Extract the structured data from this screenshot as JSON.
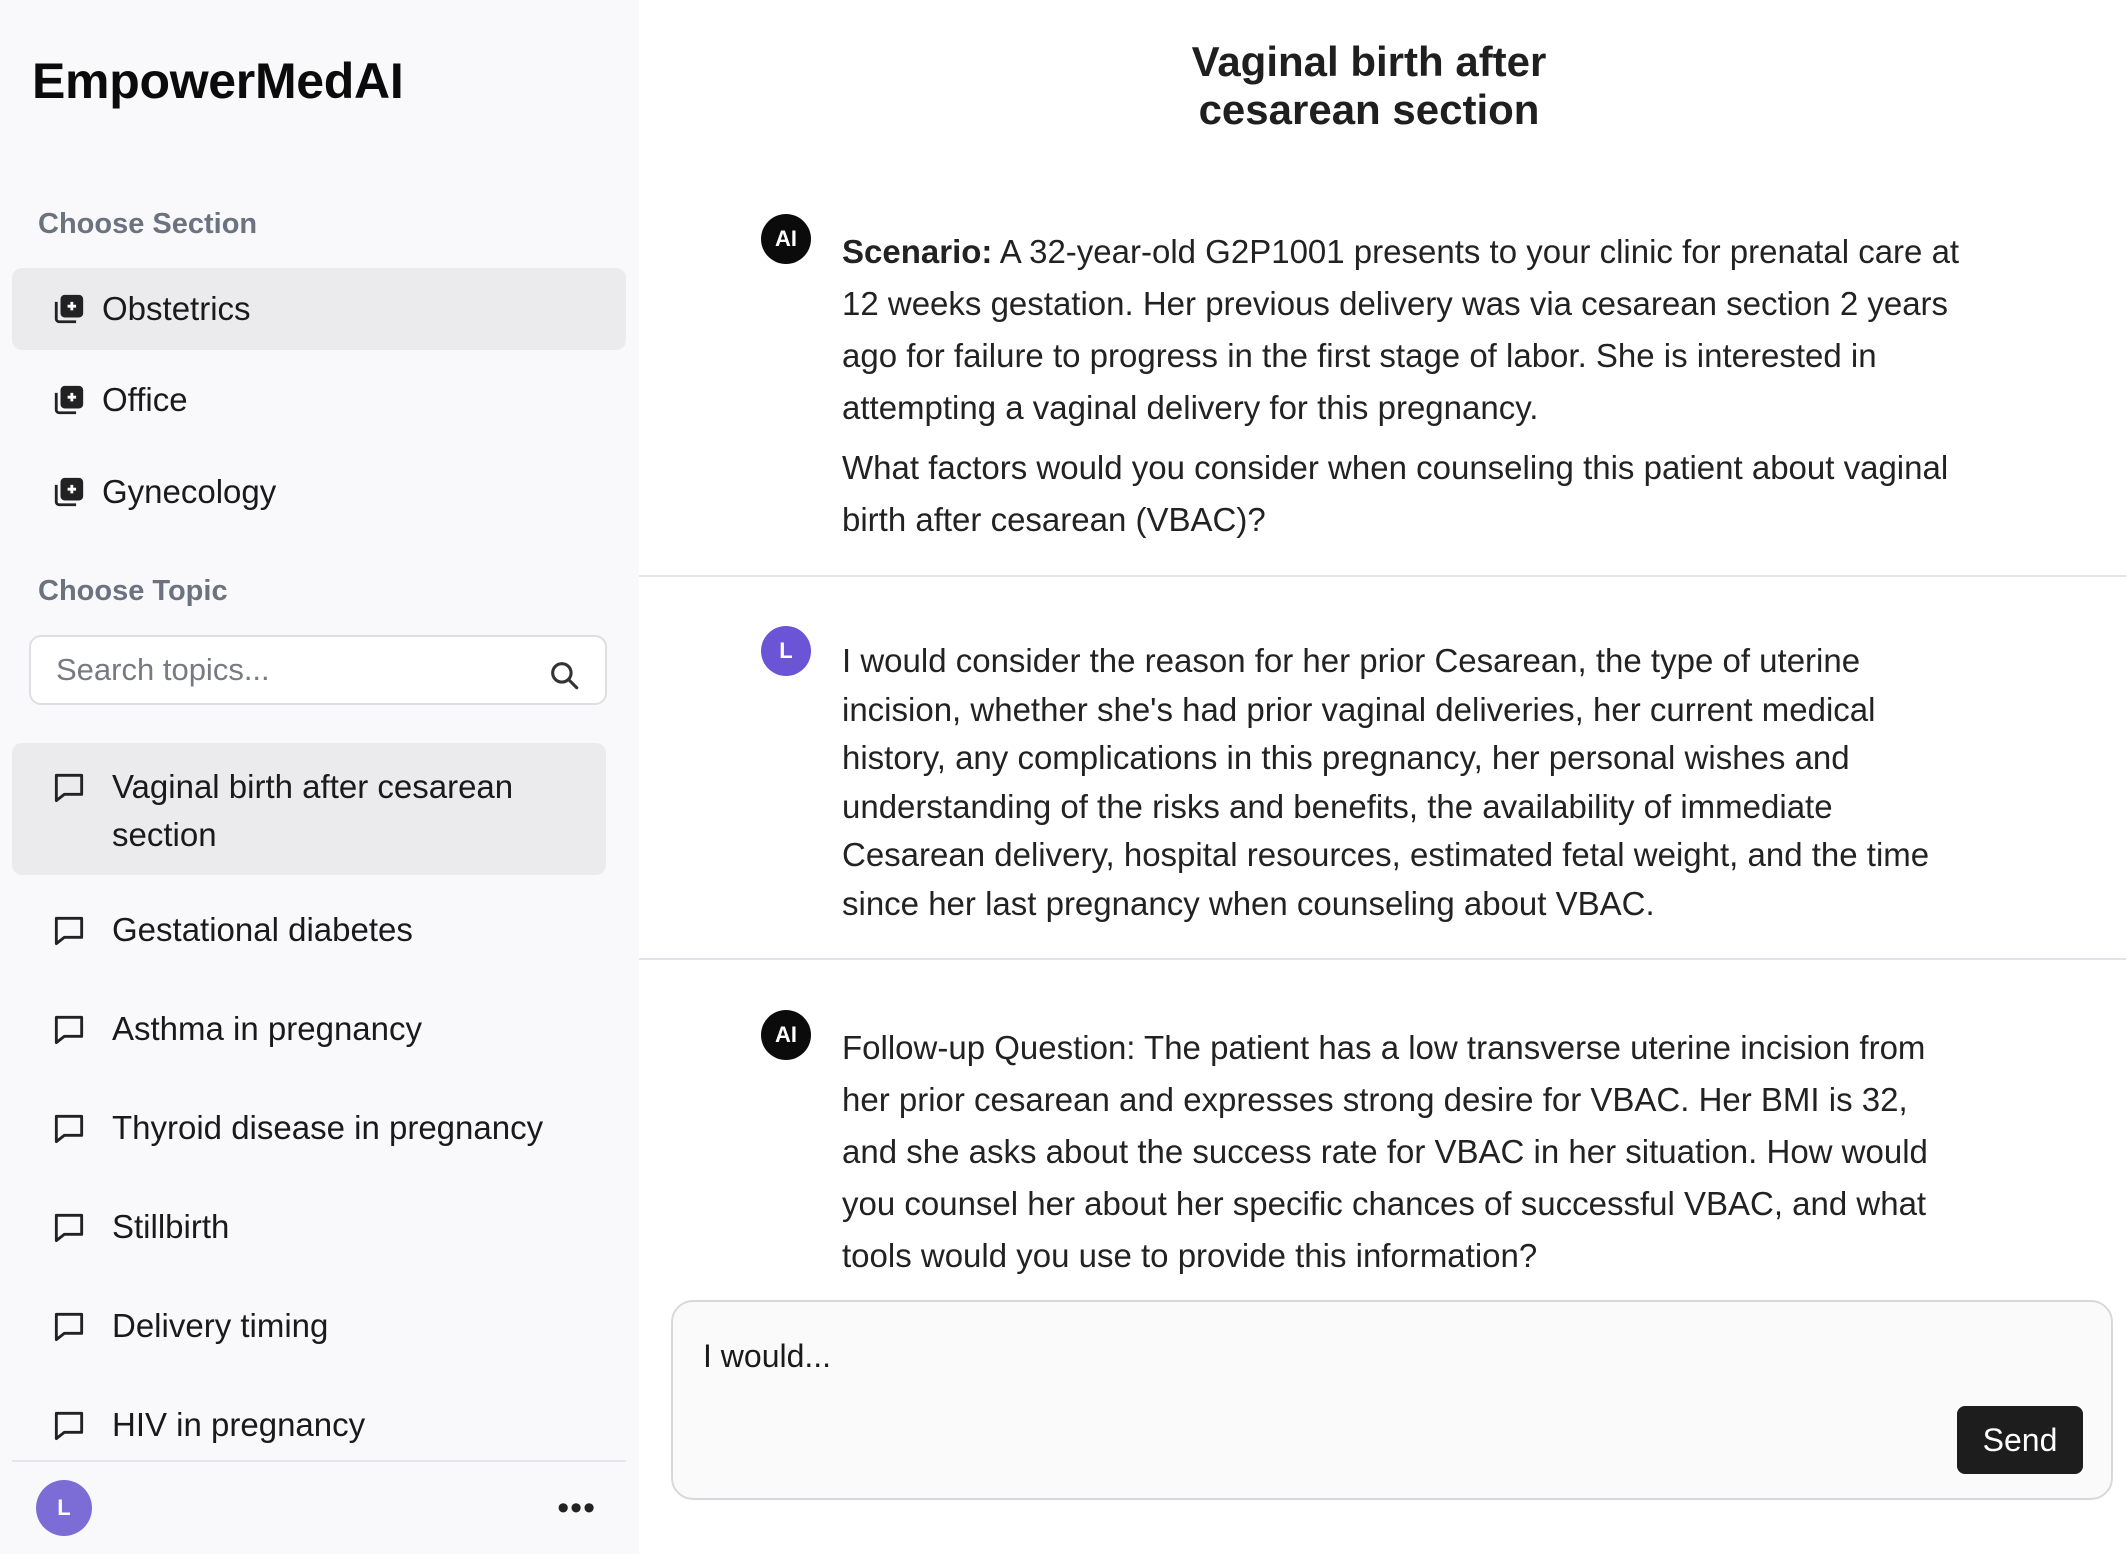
{
  "app": {
    "name": "EmpowerMedAI"
  },
  "sidebar": {
    "section_heading": "Choose Section",
    "sections": [
      {
        "label": "Obstetrics",
        "icon": "plus-square-stack-icon",
        "active": true
      },
      {
        "label": "Office",
        "icon": "plus-square-stack-icon",
        "active": false
      },
      {
        "label": "Gynecology",
        "icon": "plus-square-stack-icon",
        "active": false
      }
    ],
    "topic_heading": "Choose Topic",
    "search": {
      "placeholder": "Search topics...",
      "value": ""
    },
    "topics": [
      {
        "label": "Vaginal birth after cesarean section",
        "icon": "chat-bubble-icon",
        "active": true
      },
      {
        "label": "Gestational diabetes",
        "icon": "chat-bubble-icon",
        "active": false
      },
      {
        "label": "Asthma in pregnancy",
        "icon": "chat-bubble-icon",
        "active": false
      },
      {
        "label": "Thyroid disease in pregnancy",
        "icon": "chat-bubble-icon",
        "active": false
      },
      {
        "label": "Stillbirth",
        "icon": "chat-bubble-icon",
        "active": false
      },
      {
        "label": "Delivery timing",
        "icon": "chat-bubble-icon",
        "active": false
      },
      {
        "label": "HIV in pregnancy",
        "icon": "chat-bubble-icon",
        "active": false
      }
    ],
    "footer": {
      "user_initial": "L",
      "more_label": "•••"
    }
  },
  "main": {
    "title_line1": "Vaginal birth after",
    "title_line2": "cesarean section",
    "messages": [
      {
        "role": "ai",
        "avatar": "AI",
        "scenario_label": "Scenario:",
        "scenario_text": " A 32-year-old G2P1001 presents to your clinic for prenatal care at 12 weeks gestation. Her previous delivery was via cesarean section 2 years ago for failure to progress in the first stage of labor. She is interested in attempting a vaginal delivery for this pregnancy.",
        "question_text": "What factors would you consider when counseling this patient about vaginal birth after cesarean (VBAC)?"
      },
      {
        "role": "user",
        "avatar": "L",
        "text": "I would consider the reason for her prior Cesarean, the type of uterine incision, whether she's had prior vaginal deliveries, her current medical history, any complications in this pregnancy, her personal wishes and understanding of the risks and benefits, the availability of immediate Cesarean delivery, hospital resources, estimated fetal weight, and the time since her last pregnancy when counseling about VBAC."
      },
      {
        "role": "ai",
        "avatar": "AI",
        "text": "Follow-up Question: The patient has a low transverse uterine incision from her prior cesarean and expresses strong desire for VBAC. Her BMI is 32, and she asks about the success rate for VBAC in her situation. How would you counsel her about her specific chances of successful VBAC, and what tools would you use to provide this information?"
      }
    ],
    "composer": {
      "draft_text": "I would...",
      "send_label": "Send"
    }
  },
  "colors": {
    "sidebar_bg": "#f9f9fb",
    "active_item_bg": "#ebebee",
    "ai_avatar": "#0b0b0b",
    "user_avatar": "#6b55d6",
    "send_button": "#1d1d1d",
    "muted_label": "#6b7280"
  }
}
